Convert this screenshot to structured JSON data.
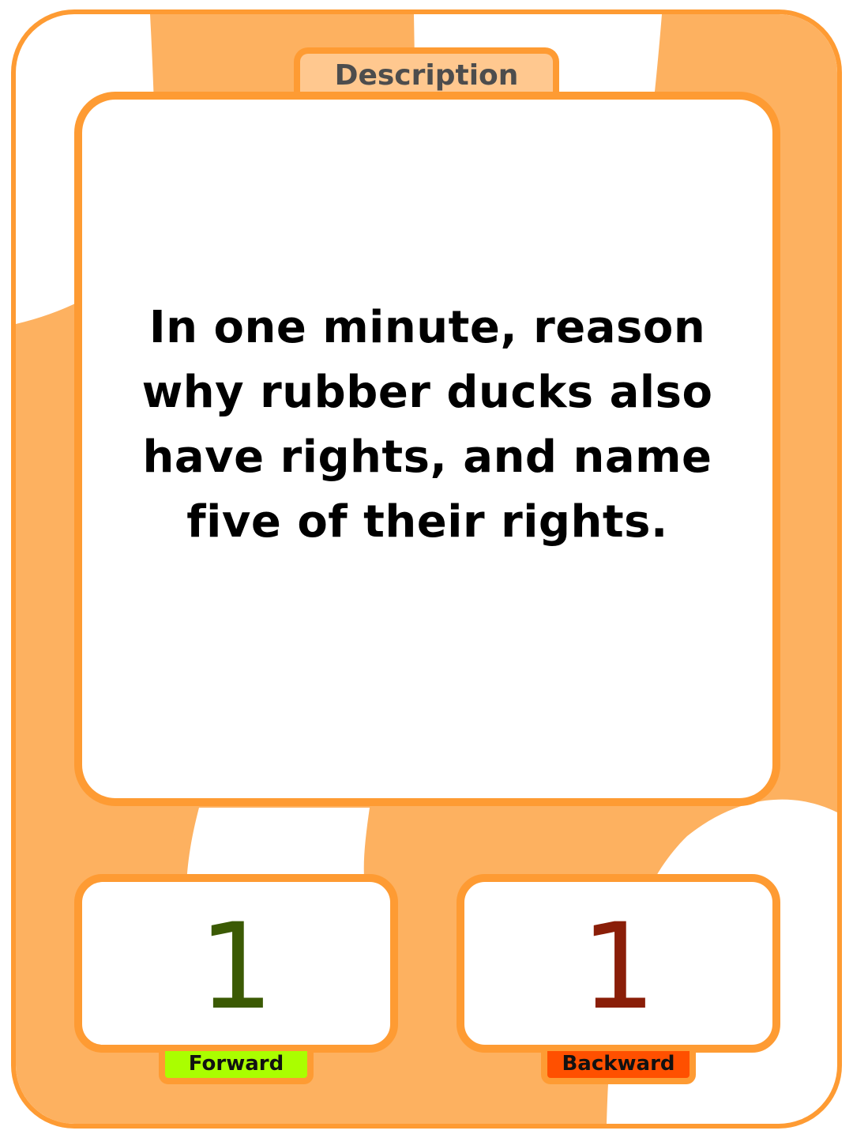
{
  "card": {
    "tab_label": "Description",
    "prompt": "In one minute, reason why rubber ducks also have rights, and name five of their rights.",
    "forward": {
      "value": "1",
      "label": "Forward"
    },
    "backward": {
      "value": "1",
      "label": "Backward"
    }
  },
  "colors": {
    "border": "#fe9b33",
    "background_stripe": "#fdb160",
    "tab_fill": "#ffc88f",
    "forward_label_fill": "#aafe00",
    "backward_label_fill": "#ff5000",
    "forward_value": "#3b5a04",
    "backward_value": "#8a1e08",
    "text": "#000000"
  }
}
